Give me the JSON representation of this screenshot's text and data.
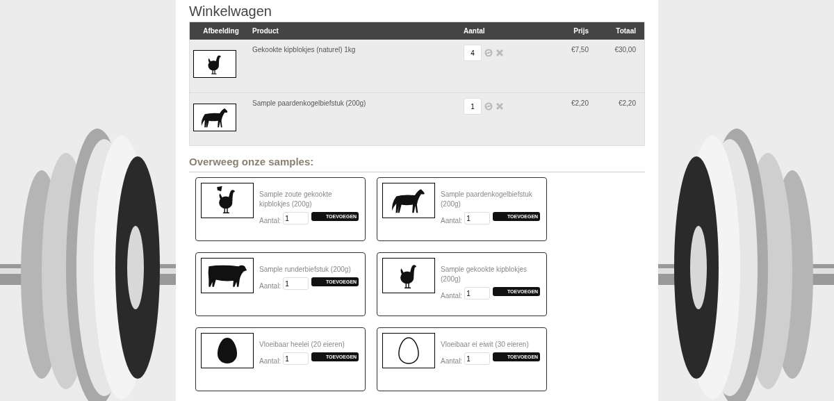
{
  "cart": {
    "title": "Winkelwagen",
    "columns": [
      "Afbeelding",
      "Product",
      "Aantal",
      "Prijs",
      "Totaal"
    ],
    "rows": [
      {
        "kind": "chicken",
        "product": "Gekookte kipblokjes (naturel) 1kg",
        "quantity": "4",
        "price": "€7,50",
        "total": "€30,00"
      },
      {
        "kind": "horse",
        "product": "Sample paardenkogelbiefstuk (200g)",
        "quantity": "1",
        "price": "€2,20",
        "total": "€2,20"
      }
    ]
  },
  "samples": {
    "title": "Overweeg onze samples:",
    "items": [
      {
        "kind": "salt-chicken",
        "name": "Sample zoute gekookte kipblokjes (200g)",
        "quantity_label": "Aantal:",
        "quantity": "1",
        "button": "TOEVOEGEN"
      },
      {
        "kind": "horse",
        "name": "Sample paardenkogelbiefstuk (200g)",
        "quantity_label": "Aantal:",
        "quantity": "1",
        "button": "TOEVOEGEN"
      },
      {
        "kind": "cow",
        "name": "Sample runderbiefstuk (200g)",
        "quantity_label": "Aantal:",
        "quantity": "1",
        "button": "TOEVOEGEN"
      },
      {
        "kind": "chicken",
        "name": "Sample gekookte kipblokjes (200g)",
        "quantity_label": "Aantal:",
        "quantity": "1",
        "button": "TOEVOEGEN"
      },
      {
        "kind": "egg",
        "name": "Vloeibaar heelei (20 eieren)",
        "quantity_label": "Aantal:",
        "quantity": "1",
        "button": "TOEVOEGEN"
      },
      {
        "kind": "egg-outline",
        "name": "Vloeibaar ei eiwit (30 eieren)",
        "quantity_label": "Aantal:",
        "quantity": "1",
        "button": "TOEVOEGEN"
      }
    ]
  }
}
